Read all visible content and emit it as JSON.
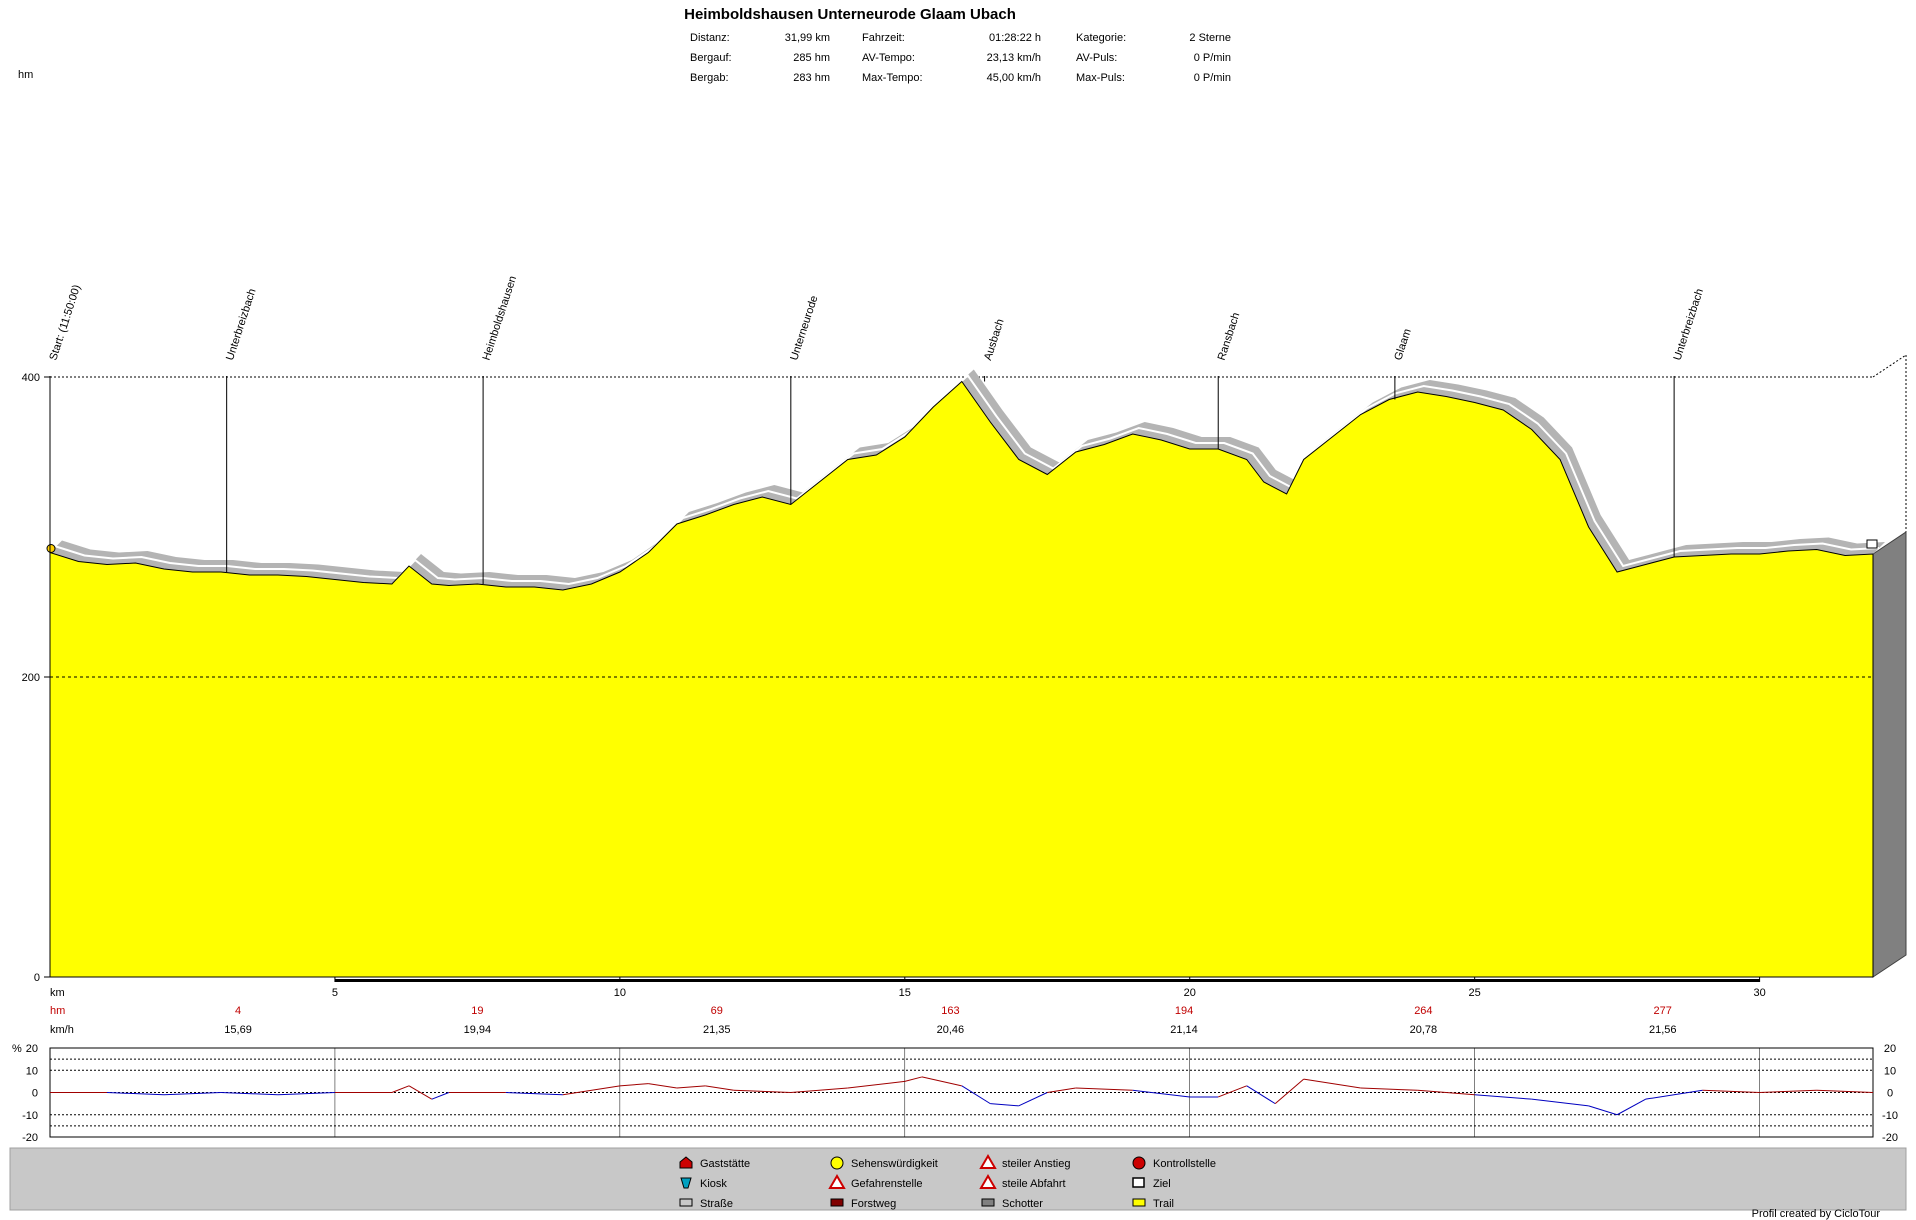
{
  "header": {
    "title": "Heimboldshausen Unterneurode Glaam Ubach",
    "stats": [
      {
        "label": "Distanz:",
        "value": "31,99 km"
      },
      {
        "label": "Bergauf:",
        "value": "285 hm"
      },
      {
        "label": "Bergab:",
        "value": "283 hm"
      },
      {
        "label": "Fahrzeit:",
        "value": "01:28:22 h"
      },
      {
        "label": "AV-Tempo:",
        "value": "23,13 km/h"
      },
      {
        "label": "Max-Tempo:",
        "value": "45,00 km/h"
      },
      {
        "label": "Kategorie:",
        "value": "2 Sterne"
      },
      {
        "label": "AV-Puls:",
        "value": "0 P/min"
      },
      {
        "label": "Max-Puls:",
        "value": "0 P/min"
      }
    ]
  },
  "chart_data": {
    "type": "area",
    "ylabel": "hm",
    "xlabel": "km",
    "ylim": [
      0,
      400
    ],
    "yticks": [
      "400",
      "200",
      "0"
    ],
    "xlim": [
      0,
      31.99
    ],
    "xticks": [
      "5",
      "10",
      "15",
      "20",
      "25",
      "30"
    ],
    "fill_color": "#ffff00",
    "x": [
      0,
      0.5,
      1,
      1.5,
      2,
      2.5,
      3,
      3.5,
      4,
      4.5,
      5,
      5.5,
      6,
      6.3,
      6.7,
      7,
      7.5,
      8,
      8.5,
      9,
      9.5,
      10,
      10.5,
      11,
      11.5,
      12,
      12.5,
      13,
      13.5,
      14,
      14.5,
      15,
      15.5,
      16,
      16.5,
      17,
      17.5,
      18,
      18.5,
      19,
      19.5,
      20,
      20.5,
      21,
      21.3,
      21.7,
      22,
      22.5,
      23,
      23.5,
      24,
      24.5,
      25,
      25.5,
      26,
      26.5,
      27,
      27.5,
      28,
      28.5,
      29,
      29.5,
      30,
      30.5,
      31,
      31.5,
      31.99
    ],
    "y": [
      283,
      277,
      275,
      276,
      272,
      270,
      270,
      268,
      268,
      267,
      265,
      263,
      262,
      274,
      262,
      261,
      262,
      260,
      260,
      258,
      262,
      270,
      283,
      302,
      308,
      315,
      320,
      315,
      330,
      345,
      348,
      360,
      380,
      397,
      370,
      345,
      335,
      350,
      355,
      362,
      358,
      352,
      352,
      345,
      330,
      322,
      345,
      360,
      375,
      385,
      390,
      387,
      383,
      378,
      365,
      345,
      300,
      270,
      275,
      280,
      281,
      282,
      282,
      284,
      285,
      281,
      282
    ],
    "waypoints": [
      {
        "label": "Start: (11:50:00)",
        "km": 0
      },
      {
        "label": "Unterbreizbach",
        "km": 3.1
      },
      {
        "label": "Heimboldshausen",
        "km": 7.6
      },
      {
        "label": "Unterneurode",
        "km": 13
      },
      {
        "label": "Ausbach",
        "km": 16.4
      },
      {
        "label": "Ransbach",
        "km": 20.5
      },
      {
        "label": "Glaam",
        "km": 23.6
      },
      {
        "label": "Unterbreizbach",
        "km": 28.5
      }
    ],
    "segments": [
      {
        "label_hm": "hm",
        "label_kmh": "km/h"
      },
      {
        "km": 3.3,
        "hm": "4",
        "kmh": "15,69"
      },
      {
        "km": 7.5,
        "hm": "19",
        "kmh": "19,94"
      },
      {
        "km": 11.7,
        "hm": "69",
        "kmh": "21,35"
      },
      {
        "km": 15.8,
        "hm": "163",
        "kmh": "20,46"
      },
      {
        "km": 19.9,
        "hm": "194",
        "kmh": "21,14"
      },
      {
        "km": 24.1,
        "hm": "264",
        "kmh": "20,78"
      },
      {
        "km": 28.3,
        "hm": "277",
        "kmh": "21,56"
      }
    ],
    "gradient": {
      "ylabel": "%",
      "yticks": [
        "20",
        "10",
        "0",
        "-10",
        "-20"
      ],
      "x": [
        0,
        1,
        2,
        3,
        4,
        5,
        6,
        6.3,
        6.7,
        7,
        8,
        9,
        10,
        10.5,
        11,
        11.5,
        12,
        13,
        14,
        15,
        15.3,
        16,
        16.5,
        17,
        17.5,
        18,
        19,
        20,
        20.5,
        21,
        21.5,
        22,
        23,
        24,
        25,
        26,
        27,
        27.5,
        28,
        29,
        30,
        31,
        31.99
      ],
      "y": [
        0,
        0,
        -1,
        0,
        -1,
        0,
        0,
        3,
        -3,
        0,
        0,
        -1,
        3,
        4,
        2,
        3,
        1,
        0,
        2,
        5,
        7,
        3,
        -5,
        -6,
        0,
        2,
        1,
        -2,
        -2,
        3,
        -5,
        6,
        2,
        1,
        -1,
        -3,
        -6,
        -10,
        -3,
        1,
        0,
        1,
        0
      ]
    }
  },
  "legend": {
    "items": [
      {
        "label": "Gaststätte",
        "icon": "house-icon",
        "color": "#cc0000"
      },
      {
        "label": "Kiosk",
        "icon": "kiosk-icon",
        "color": "#00a0c0"
      },
      {
        "label": "Straße",
        "icon": "road-swatch",
        "color": "#c8c8c8"
      },
      {
        "label": "Sehenswürdigkeit",
        "icon": "smiley-icon",
        "color": "#ffff00"
      },
      {
        "label": "Gefahrenstelle",
        "icon": "warning-icon",
        "color": "#cc0000"
      },
      {
        "label": "Forstweg",
        "icon": "forest-swatch",
        "color": "#800000"
      },
      {
        "label": "steiler Anstieg",
        "icon": "steep-up-icon",
        "color": "#cc0000"
      },
      {
        "label": "steile Abfahrt",
        "icon": "steep-down-icon",
        "color": "#cc0000"
      },
      {
        "label": "Schotter",
        "icon": "gravel-swatch",
        "color": "#808080"
      },
      {
        "label": "Kontrollstelle",
        "icon": "stop-icon",
        "color": "#cc0000"
      },
      {
        "label": "Ziel",
        "icon": "finish-flag-icon",
        "color": "#000000"
      },
      {
        "label": "Trail",
        "icon": "trail-swatch",
        "color": "#ffff00"
      }
    ]
  },
  "footer": {
    "credit": "Profil created by CicloTour"
  }
}
